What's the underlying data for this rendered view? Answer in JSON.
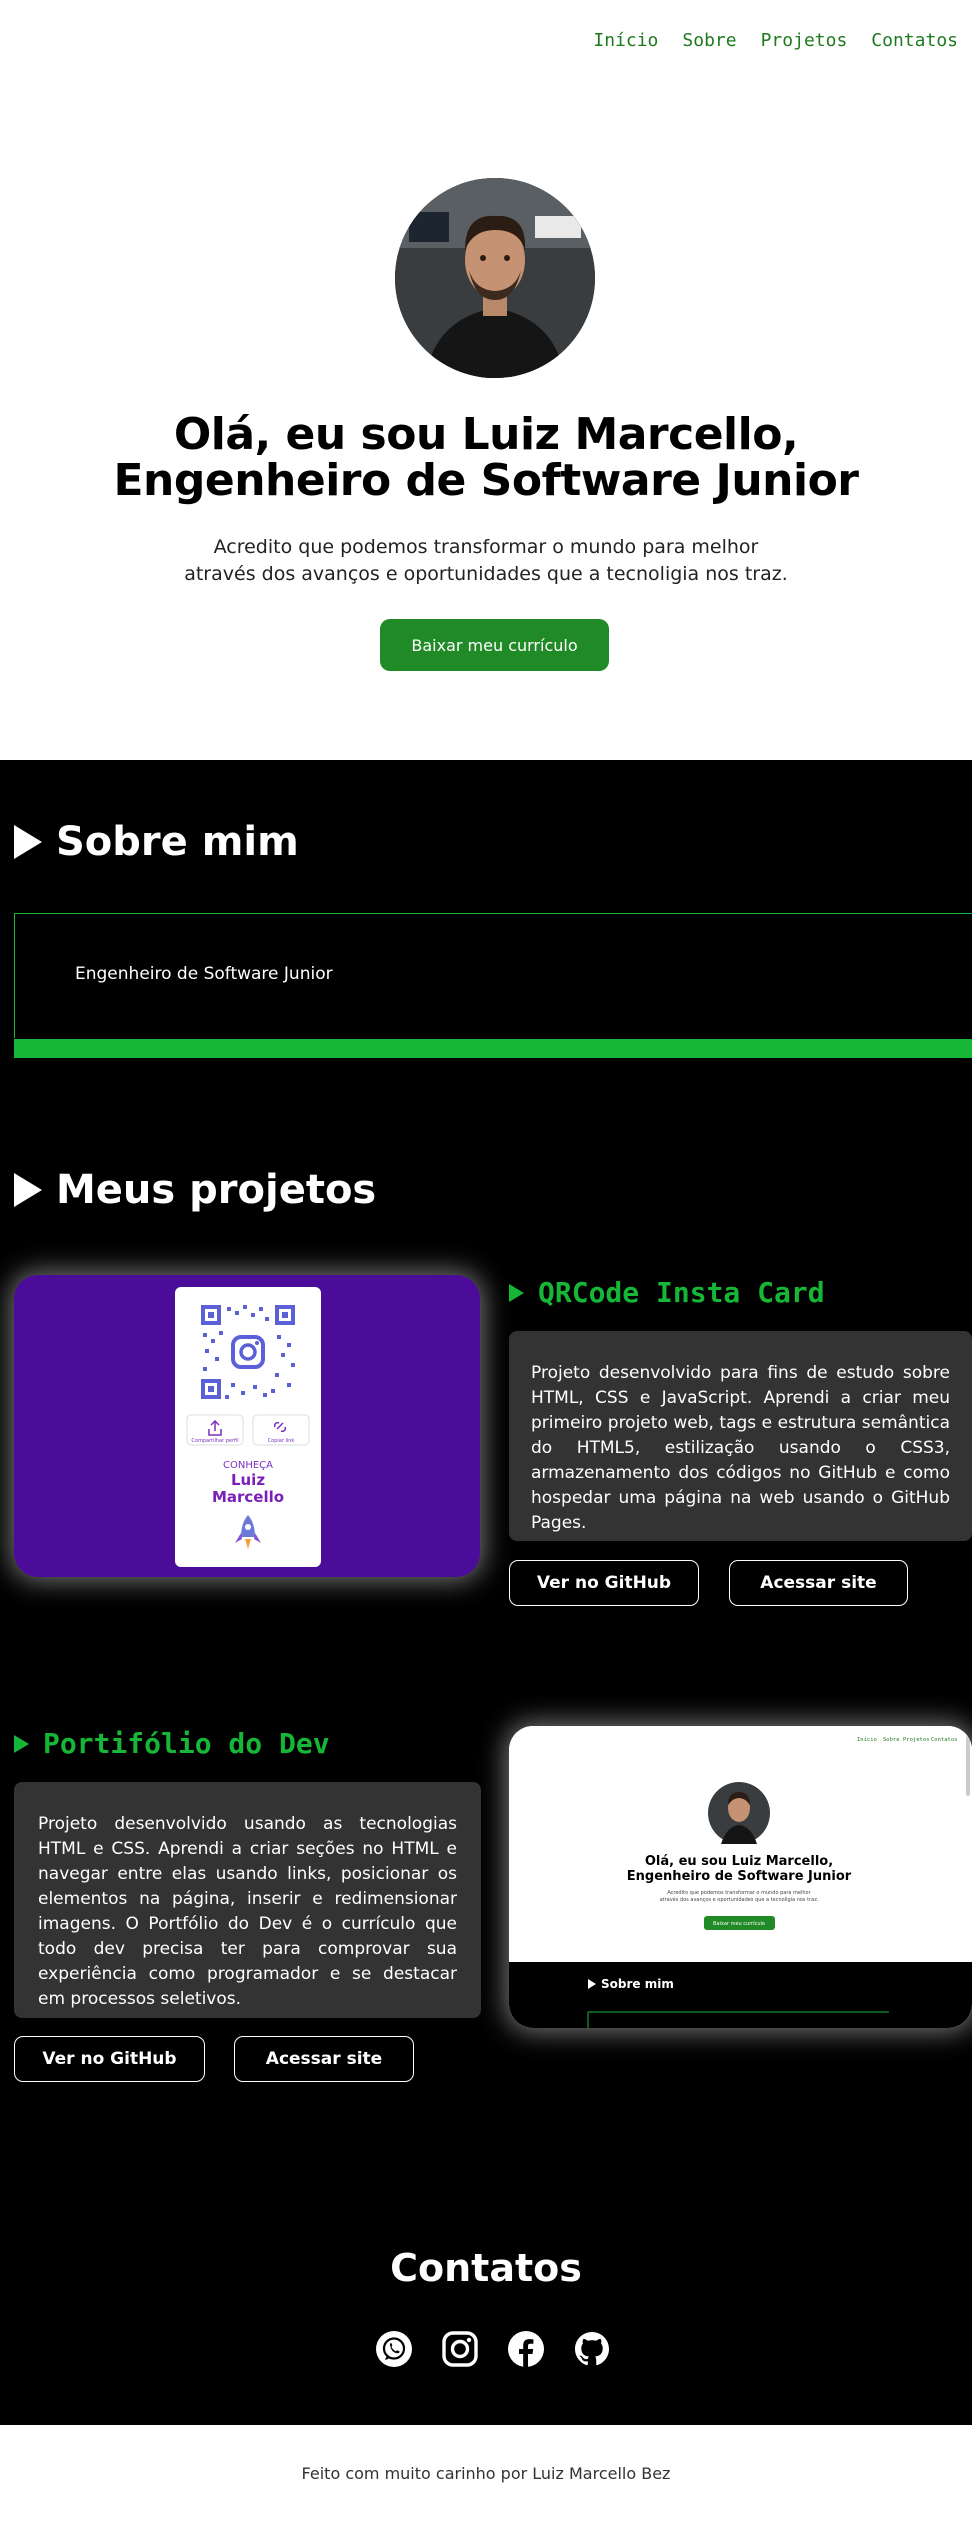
{
  "nav": {
    "items": [
      "Início",
      "Sobre",
      "Projetos",
      "Contatos"
    ]
  },
  "hero": {
    "title_line1": "Olá, eu sou Luiz Marcello,",
    "title_line2": "Engenheiro de Software Junior",
    "text_line1": "Acredito que podemos transformar o mundo para melhor",
    "text_line2": "através dos avanços e oportunidades que a tecnoligia nos traz.",
    "cv_button": "Baixar meu currículo"
  },
  "about": {
    "title": "Sobre mim",
    "text": "Engenheiro de Software Junior"
  },
  "projects": {
    "title": "Meus projetos",
    "items": [
      {
        "name": "QRCode Insta Card",
        "description": "Projeto desenvolvido para fins de estudo sobre HTML, CSS e JavaScript. Aprendi a criar meu primeiro projeto web, tags e estrutura semântica do HTML5, estilização usando o CSS3, armazenamento dos códigos no GitHub e como hospedar uma página na web usando o GitHub Pages.",
        "github_label": "Ver no GitHub",
        "site_label": "Acessar site",
        "card": {
          "share_label": "Compartilhar perfil",
          "copy_label": "Copiar link",
          "greeting": "CONHEÇA",
          "name1": "Luiz",
          "name2": "Marcello"
        }
      },
      {
        "name": "Portifólio do Dev",
        "description": "Projeto desenvolvido usando as tecnologias HTML e CSS. Aprendi a criar seções no HTML e navegar entre elas usando links, posicionar os elementos na página, inserir e redimensionar imagens. O Portfólio do Dev é o currículo que todo dev precisa ter para comprovar sua experiência como programador e se destacar em processos seletivos.",
        "github_label": "Ver no GitHub",
        "site_label": "Acessar site",
        "preview": {
          "nav": [
            "Início",
            "Sobre",
            "Projetos",
            "Contatos"
          ],
          "title_line1": "Olá, eu sou Luiz Marcello,",
          "title_line2": "Engenheiro de Software Junior",
          "text_line1": "Acredito que podemos transformar o mundo para melhor",
          "text_line2": "através dos avanços e oportunidades que a tecnoligia nos traz.",
          "button": "Baixar meu currículo",
          "section": "Sobre mim"
        }
      }
    ]
  },
  "contacts": {
    "title": "Contatos",
    "icons": [
      "whatsapp-icon",
      "instagram-icon",
      "facebook-icon",
      "github-icon"
    ]
  },
  "footer": {
    "text": "Feito com muito carinho por Luiz Marcello Bez"
  },
  "colors": {
    "green": "#16b637",
    "button_green": "#208a26",
    "purple": "#4c0c9a",
    "box_gray": "#333333"
  }
}
